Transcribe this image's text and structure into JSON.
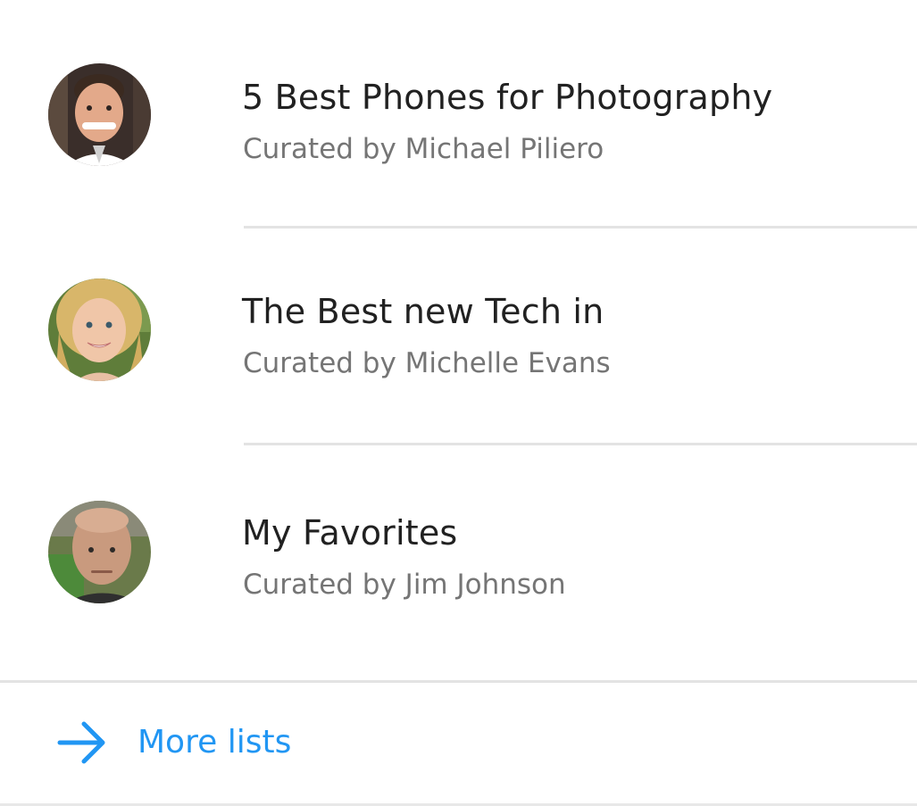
{
  "lists": [
    {
      "title": "5 Best Phones for Photography",
      "curator": "Curated by Michael Piliero",
      "avatar": "person-avatar"
    },
    {
      "title": "The Best new Tech in",
      "curator": "Curated by Michelle Evans",
      "avatar": "person-avatar"
    },
    {
      "title": "My Favorites",
      "curator": "Curated by Jim Johnson",
      "avatar": "person-avatar"
    }
  ],
  "more": {
    "label": "More lists",
    "icon": "arrow-right-icon"
  },
  "colors": {
    "accent": "#2196f3",
    "title": "#212121",
    "subtitle": "#757575",
    "divider": "#e3e3e3"
  }
}
